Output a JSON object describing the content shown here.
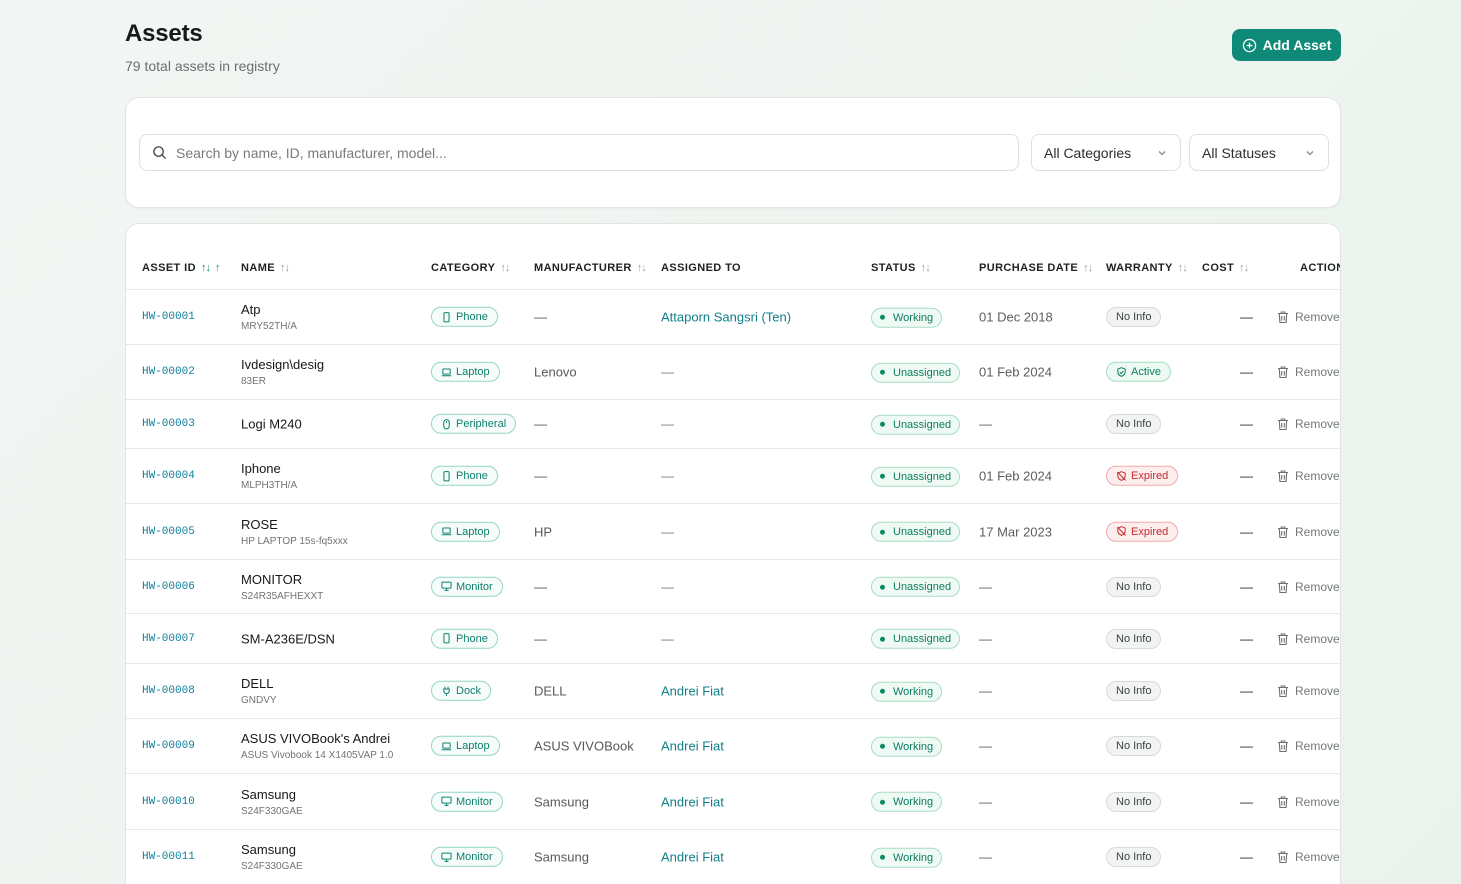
{
  "header": {
    "title": "Assets",
    "subtitle": "79 total assets in registry",
    "add_button": "Add Asset"
  },
  "filters": {
    "search_placeholder": "Search by name, ID, manufacturer, model...",
    "category_select": "All Categories",
    "status_select": "All Statuses"
  },
  "table": {
    "columns": {
      "asset_id": "ASSET ID",
      "name": "NAME",
      "category": "CATEGORY",
      "manufacturer": "MANUFACTURER",
      "assigned_to": "ASSIGNED TO",
      "status": "STATUS",
      "purchase_date": "PURCHASE DATE",
      "warranty": "WARRANTY",
      "cost": "COST",
      "actions": "ACTIONS"
    },
    "sort_glyph": "↑↓",
    "sort_active_glyph": "↑",
    "remove_label": "Remove",
    "rows": [
      {
        "id": "HW-00001",
        "name": "Atp",
        "model": "MRY52TH/A",
        "category": "Phone",
        "cat_icon": "phone-icon",
        "manufacturer": "—",
        "assigned": "Attaporn Sangsri (Ten)",
        "status": "Working",
        "purchase_date": "01 Dec 2018",
        "warranty": "No Info",
        "warranty_type": "none",
        "cost": "—"
      },
      {
        "id": "HW-00002",
        "name": "Ivdesign\\desig",
        "model": "83ER",
        "category": "Laptop",
        "cat_icon": "laptop-icon",
        "manufacturer": "Lenovo",
        "assigned": "—",
        "status": "Unassigned",
        "purchase_date": "01 Feb 2024",
        "warranty": "Active",
        "warranty_type": "active",
        "cost": "—"
      },
      {
        "id": "HW-00003",
        "name": "Logi M240",
        "model": "",
        "category": "Peripheral",
        "cat_icon": "mouse-icon",
        "manufacturer": "—",
        "assigned": "—",
        "status": "Unassigned",
        "purchase_date": "—",
        "warranty": "No Info",
        "warranty_type": "none",
        "cost": "—"
      },
      {
        "id": "HW-00004",
        "name": "Iphone",
        "model": "MLPH3TH/A",
        "category": "Phone",
        "cat_icon": "phone-icon",
        "manufacturer": "—",
        "assigned": "—",
        "status": "Unassigned",
        "purchase_date": "01 Feb 2024",
        "warranty": "Expired",
        "warranty_type": "expired",
        "cost": "—"
      },
      {
        "id": "HW-00005",
        "name": "ROSE",
        "model": "HP LAPTOP 15s-fq5xxx",
        "category": "Laptop",
        "cat_icon": "laptop-icon",
        "manufacturer": "HP",
        "assigned": "—",
        "status": "Unassigned",
        "purchase_date": "17 Mar 2023",
        "warranty": "Expired",
        "warranty_type": "expired",
        "cost": "—"
      },
      {
        "id": "HW-00006",
        "name": "MONITOR",
        "model": "S24R35AFHEXXT",
        "category": "Monitor",
        "cat_icon": "monitor-icon",
        "manufacturer": "—",
        "assigned": "—",
        "status": "Unassigned",
        "purchase_date": "—",
        "warranty": "No Info",
        "warranty_type": "none",
        "cost": "—"
      },
      {
        "id": "HW-00007",
        "name": "SM-A236E/DSN",
        "model": "",
        "category": "Phone",
        "cat_icon": "phone-icon",
        "manufacturer": "—",
        "assigned": "—",
        "status": "Unassigned",
        "purchase_date": "—",
        "warranty": "No Info",
        "warranty_type": "none",
        "cost": "—"
      },
      {
        "id": "HW-00008",
        "name": "DELL",
        "model": "GNDVY",
        "category": "Dock",
        "cat_icon": "plug-icon",
        "manufacturer": "DELL",
        "assigned": "Andrei Fiat",
        "status": "Working",
        "purchase_date": "—",
        "warranty": "No Info",
        "warranty_type": "none",
        "cost": "—"
      },
      {
        "id": "HW-00009",
        "name": "ASUS VIVOBook's Andrei",
        "model": "ASUS Vivobook 14 X1405VAP 1.0",
        "category": "Laptop",
        "cat_icon": "laptop-icon",
        "manufacturer": "ASUS VIVOBook",
        "assigned": "Andrei Fiat",
        "status": "Working",
        "purchase_date": "—",
        "warranty": "No Info",
        "warranty_type": "none",
        "cost": "—"
      },
      {
        "id": "HW-00010",
        "name": "Samsung",
        "model": "S24F330GAE",
        "category": "Monitor",
        "cat_icon": "monitor-icon",
        "manufacturer": "Samsung",
        "assigned": "Andrei Fiat",
        "status": "Working",
        "purchase_date": "—",
        "warranty": "No Info",
        "warranty_type": "none",
        "cost": "—"
      },
      {
        "id": "HW-00011",
        "name": "Samsung",
        "model": "S24F330GAE",
        "category": "Monitor",
        "cat_icon": "monitor-icon",
        "manufacturer": "Samsung",
        "assigned": "Andrei Fiat",
        "status": "Working",
        "purchase_date": "—",
        "warranty": "No Info",
        "warranty_type": "none",
        "cost": "—"
      }
    ]
  },
  "colors": {
    "accent": "#0f8a78",
    "link": "#117e88",
    "expired": "#c8282d"
  }
}
